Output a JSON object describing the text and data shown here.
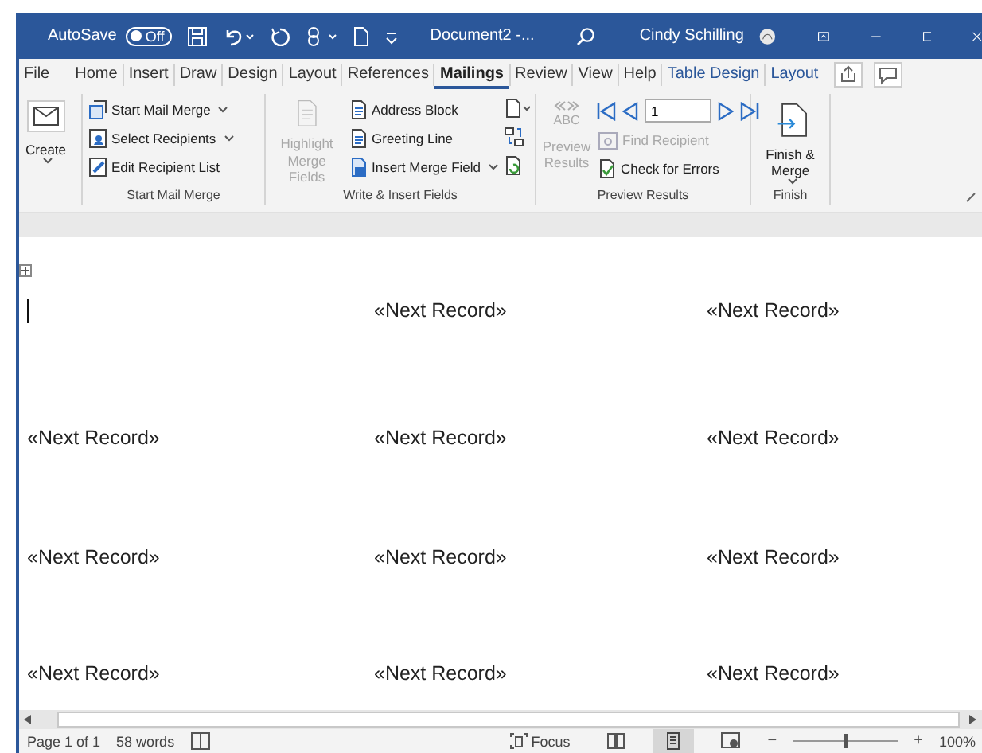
{
  "title_bar": {
    "autosave_label": "AutoSave",
    "autosave_toggle": {
      "label": "Off",
      "on": false
    },
    "document_title": "Document2 -...",
    "user_name": "Cindy Schilling"
  },
  "tabs": [
    {
      "label": "File",
      "selected": false,
      "contextual": false
    },
    {
      "label": "Home",
      "selected": false,
      "contextual": false
    },
    {
      "label": "Insert",
      "selected": false,
      "contextual": false
    },
    {
      "label": "Draw",
      "selected": false,
      "contextual": false
    },
    {
      "label": "Design",
      "selected": false,
      "contextual": false
    },
    {
      "label": "Layout",
      "selected": false,
      "contextual": false
    },
    {
      "label": "References",
      "selected": false,
      "contextual": false
    },
    {
      "label": "Mailings",
      "selected": true,
      "contextual": false
    },
    {
      "label": "Review",
      "selected": false,
      "contextual": false
    },
    {
      "label": "View",
      "selected": false,
      "contextual": false
    },
    {
      "label": "Help",
      "selected": false,
      "contextual": false
    },
    {
      "label": "Table Design",
      "selected": false,
      "contextual": true
    },
    {
      "label": "Layout",
      "selected": false,
      "contextual": true
    }
  ],
  "ribbon": {
    "create": {
      "label": "Create"
    },
    "start_mail_merge": {
      "label": "Start Mail Merge",
      "items": [
        {
          "label": "Start Mail Merge",
          "dropdown": true
        },
        {
          "label": "Select Recipients",
          "dropdown": true
        },
        {
          "label": "Edit Recipient List",
          "dropdown": false
        }
      ]
    },
    "write_insert_fields": {
      "label": "Write & Insert Fields",
      "highlight": {
        "label": "Highlight Merge Fields",
        "disabled": true
      },
      "items": [
        {
          "label": "Address Block",
          "dropdown": false
        },
        {
          "label": "Greeting Line",
          "dropdown": false
        },
        {
          "label": "Insert Merge Field",
          "dropdown": true
        }
      ]
    },
    "preview_results": {
      "label": "Preview Results",
      "preview": {
        "label": "Preview Results",
        "abc": "ABC",
        "disabled": true
      },
      "record": "1",
      "find_recipient": {
        "label": "Find Recipient",
        "disabled": true
      },
      "check_errors": {
        "label": "Check for Errors",
        "disabled": false
      }
    },
    "finish": {
      "label": "Finish",
      "button": {
        "label": "Finish & Merge",
        "dropdown": true
      }
    }
  },
  "document": {
    "rows": [
      [
        {
          "kind": "cursor"
        },
        {
          "kind": "text",
          "text": "«Next Record»"
        },
        {
          "kind": "text",
          "text": "«Next Record»"
        }
      ],
      [
        {
          "kind": "text",
          "text": "«Next Record»"
        },
        {
          "kind": "text",
          "text": "«Next Record»"
        },
        {
          "kind": "text",
          "text": "«Next Record»"
        }
      ],
      [
        {
          "kind": "text",
          "text": "«Next Record»"
        },
        {
          "kind": "text",
          "text": "«Next Record»"
        },
        {
          "kind": "text",
          "text": "«Next Record»"
        }
      ],
      [
        {
          "kind": "text",
          "text": "«Next Record»"
        },
        {
          "kind": "text",
          "text": "«Next Record»"
        },
        {
          "kind": "text",
          "text": "«Next Record»"
        }
      ]
    ]
  },
  "status_bar": {
    "page": "Page 1 of 1",
    "words": "58 words",
    "focus": "Focus",
    "views": [
      {
        "selected": false
      },
      {
        "selected": true
      },
      {
        "selected": false
      }
    ],
    "zoom": {
      "minus": "−",
      "plus": "+",
      "level": 0.5,
      "percent": "100%"
    }
  }
}
